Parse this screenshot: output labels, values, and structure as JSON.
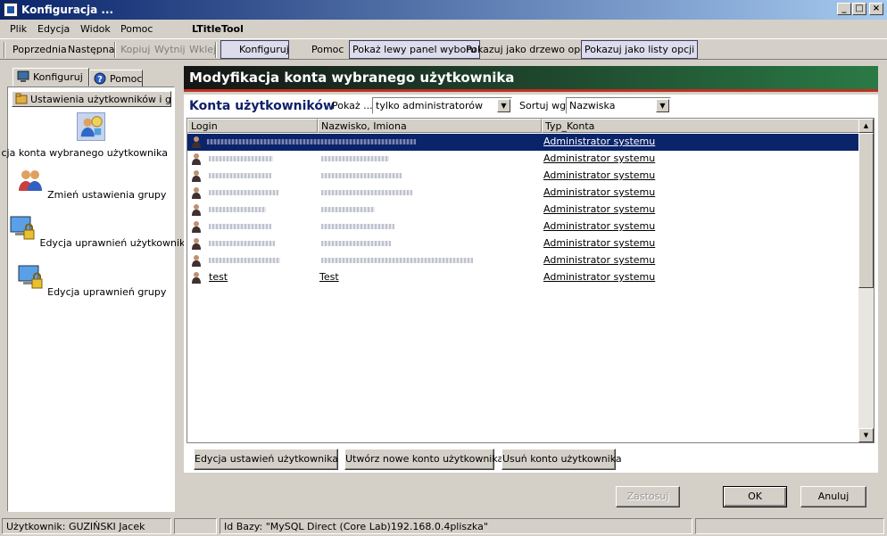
{
  "window": {
    "title": "Konfiguracja ...",
    "minimize": "_",
    "maximize": "□",
    "close": "×"
  },
  "menu": {
    "items": [
      "Plik",
      "Edycja",
      "Widok",
      "Pomoc"
    ],
    "tool_label": "LTitleTool"
  },
  "toolbar": {
    "prev": "Poprzednia",
    "next": "Następna",
    "copy": "Kopiuj",
    "cut": "Wytnij",
    "paste": "Wklej",
    "configure": "Konfiguruj",
    "help": "Pomoc",
    "show_left_panel": "Pokaż lewy panel wyboru",
    "show_tree": "Pokazuj jako drzewo opcji",
    "show_lists": "Pokazuj jako listy opcji"
  },
  "left": {
    "tabs": [
      "Konfiguruj",
      "Pomoc"
    ],
    "group": "Ustawienia użytkowników i g...",
    "items": [
      {
        "label": "Modyfikacja konta wybranego użytkownika",
        "icon": "user-edit-icon"
      },
      {
        "label": "Zmień ustawienia grupy",
        "icon": "user-group-icon"
      },
      {
        "label": "Edycja uprawnień użytkowników",
        "icon": "lock-monitor-icon"
      },
      {
        "label": "Edycja uprawnień grupy",
        "icon": "lock-monitor-icon"
      }
    ]
  },
  "main": {
    "banner": "Modyfikacja konta wybranego użytkownika",
    "section_title": "Konta użytkowników",
    "show_label": "Pokaż ...",
    "show_value": "tylko administratorów",
    "sort_label": "Sortuj wg.",
    "sort_value": "Nazwiska",
    "columns": [
      "Login",
      "Nazwisko, Imiona",
      "Typ_Konta"
    ],
    "rows": [
      {
        "login": "",
        "name": "",
        "type": "Administrator systemu",
        "selected": true
      },
      {
        "login": "",
        "name": "",
        "type": "Administrator systemu"
      },
      {
        "login": "",
        "name": "",
        "type": "Administrator systemu"
      },
      {
        "login": "",
        "name": "",
        "type": "Administrator systemu"
      },
      {
        "login": "",
        "name": "",
        "type": "Administrator systemu"
      },
      {
        "login": "",
        "name": "",
        "type": "Administrator systemu"
      },
      {
        "login": "",
        "name": "",
        "type": "Administrator systemu"
      },
      {
        "login": "",
        "name": "",
        "type": "Administrator systemu"
      },
      {
        "login": "test",
        "name": "Test",
        "type": "Administrator systemu"
      }
    ],
    "buttons": {
      "edit": "Edycja ustawień użytkownika",
      "create": "Utwórz nowe konto użytkownika",
      "delete": "Usuń konto użytkownika"
    }
  },
  "dialog": {
    "apply": "Zastosuj",
    "ok": "OK",
    "cancel": "Anuluj"
  },
  "status": {
    "user": "Użytkownik: GUZIŃSKI Jacek",
    "db": "Id Bazy: \"MySQL Direct (Core Lab)192.168.0.4pliszka\""
  },
  "colors": {
    "selection": "#0a246a",
    "section_title": "#10206a",
    "banner_start": "#151515",
    "banner_end": "#2a7a45"
  }
}
